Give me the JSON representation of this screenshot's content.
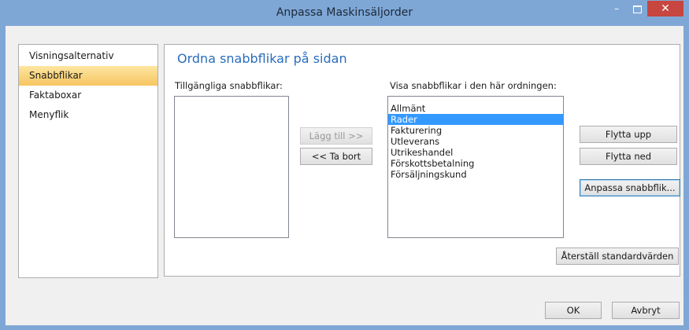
{
  "window": {
    "title": "Anpassa Maskinsäljorder",
    "minimize_glyph": "–",
    "close_glyph": "✕"
  },
  "nav": {
    "items": [
      {
        "label": "Visningsalternativ",
        "selected": false
      },
      {
        "label": "Snabbflikar",
        "selected": true
      },
      {
        "label": "Faktaboxar",
        "selected": false
      },
      {
        "label": "Menyflik",
        "selected": false
      }
    ]
  },
  "panel": {
    "heading": "Ordna snabbflikar på sidan",
    "available_label": "Tillgängliga snabbflikar:",
    "available_items": [],
    "order_label": "Visa snabbflikar i den här ordningen:",
    "order_items": [
      {
        "label": "Allmänt",
        "selected": false
      },
      {
        "label": "Rader",
        "selected": true
      },
      {
        "label": "Fakturering",
        "selected": false
      },
      {
        "label": "Utleverans",
        "selected": false
      },
      {
        "label": "Utrikeshandel",
        "selected": false
      },
      {
        "label": "Förskottsbetalning",
        "selected": false
      },
      {
        "label": "Försäljningskund",
        "selected": false
      }
    ],
    "add_button": "Lägg till >>",
    "remove_button": "<< Ta bort",
    "move_up_button": "Flytta upp",
    "move_down_button": "Flytta ned",
    "customize_button": "Anpassa snabbflik...",
    "reset_button": "Återställ standardvärden"
  },
  "footer": {
    "ok_button": "OK",
    "cancel_button": "Avbryt"
  },
  "colors": {
    "titlebar": "#7fa7d6",
    "close_button": "#c7463f",
    "heading": "#2a6dbb",
    "selection": "#3399ff",
    "nav_selection": "#f6c560"
  }
}
